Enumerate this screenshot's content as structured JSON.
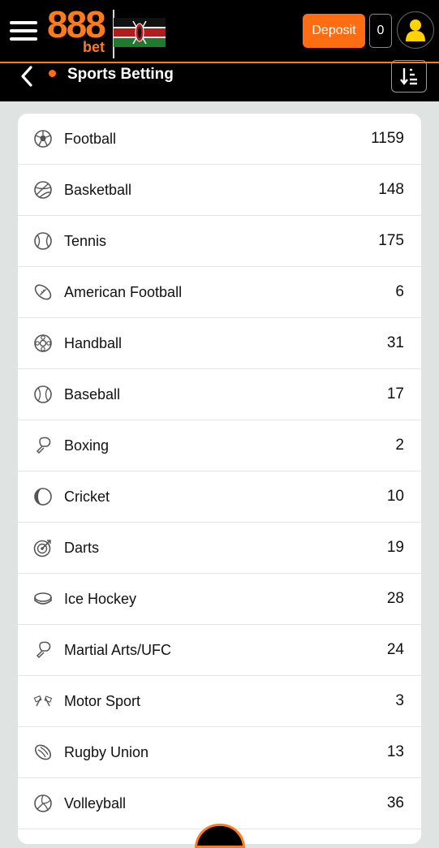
{
  "header": {
    "logo_text": "888",
    "logo_subtext": "bet",
    "deposit_label": "Deposit",
    "balance": "0",
    "colors": {
      "accent": "#ff6d12",
      "background": "#000000"
    }
  },
  "subheader": {
    "title": "Sports Betting"
  },
  "sports": [
    {
      "label": "Football",
      "count": "1159",
      "icon": "football-icon"
    },
    {
      "label": "Basketball",
      "count": "148",
      "icon": "basketball-icon"
    },
    {
      "label": "Tennis",
      "count": "175",
      "icon": "tennis-icon"
    },
    {
      "label": "American Football",
      "count": "6",
      "icon": "american-football-icon"
    },
    {
      "label": "Handball",
      "count": "31",
      "icon": "handball-icon"
    },
    {
      "label": "Baseball",
      "count": "17",
      "icon": "baseball-icon"
    },
    {
      "label": "Boxing",
      "count": "2",
      "icon": "boxing-icon"
    },
    {
      "label": "Cricket",
      "count": "10",
      "icon": "cricket-icon"
    },
    {
      "label": "Darts",
      "count": "19",
      "icon": "darts-icon"
    },
    {
      "label": "Ice Hockey",
      "count": "28",
      "icon": "ice-hockey-icon"
    },
    {
      "label": "Martial Arts/UFC",
      "count": "24",
      "icon": "martial-arts-icon"
    },
    {
      "label": "Motor Sport",
      "count": "3",
      "icon": "motor-sport-icon"
    },
    {
      "label": "Rugby Union",
      "count": "13",
      "icon": "rugby-icon"
    },
    {
      "label": "Volleyball",
      "count": "36",
      "icon": "volleyball-icon"
    }
  ]
}
